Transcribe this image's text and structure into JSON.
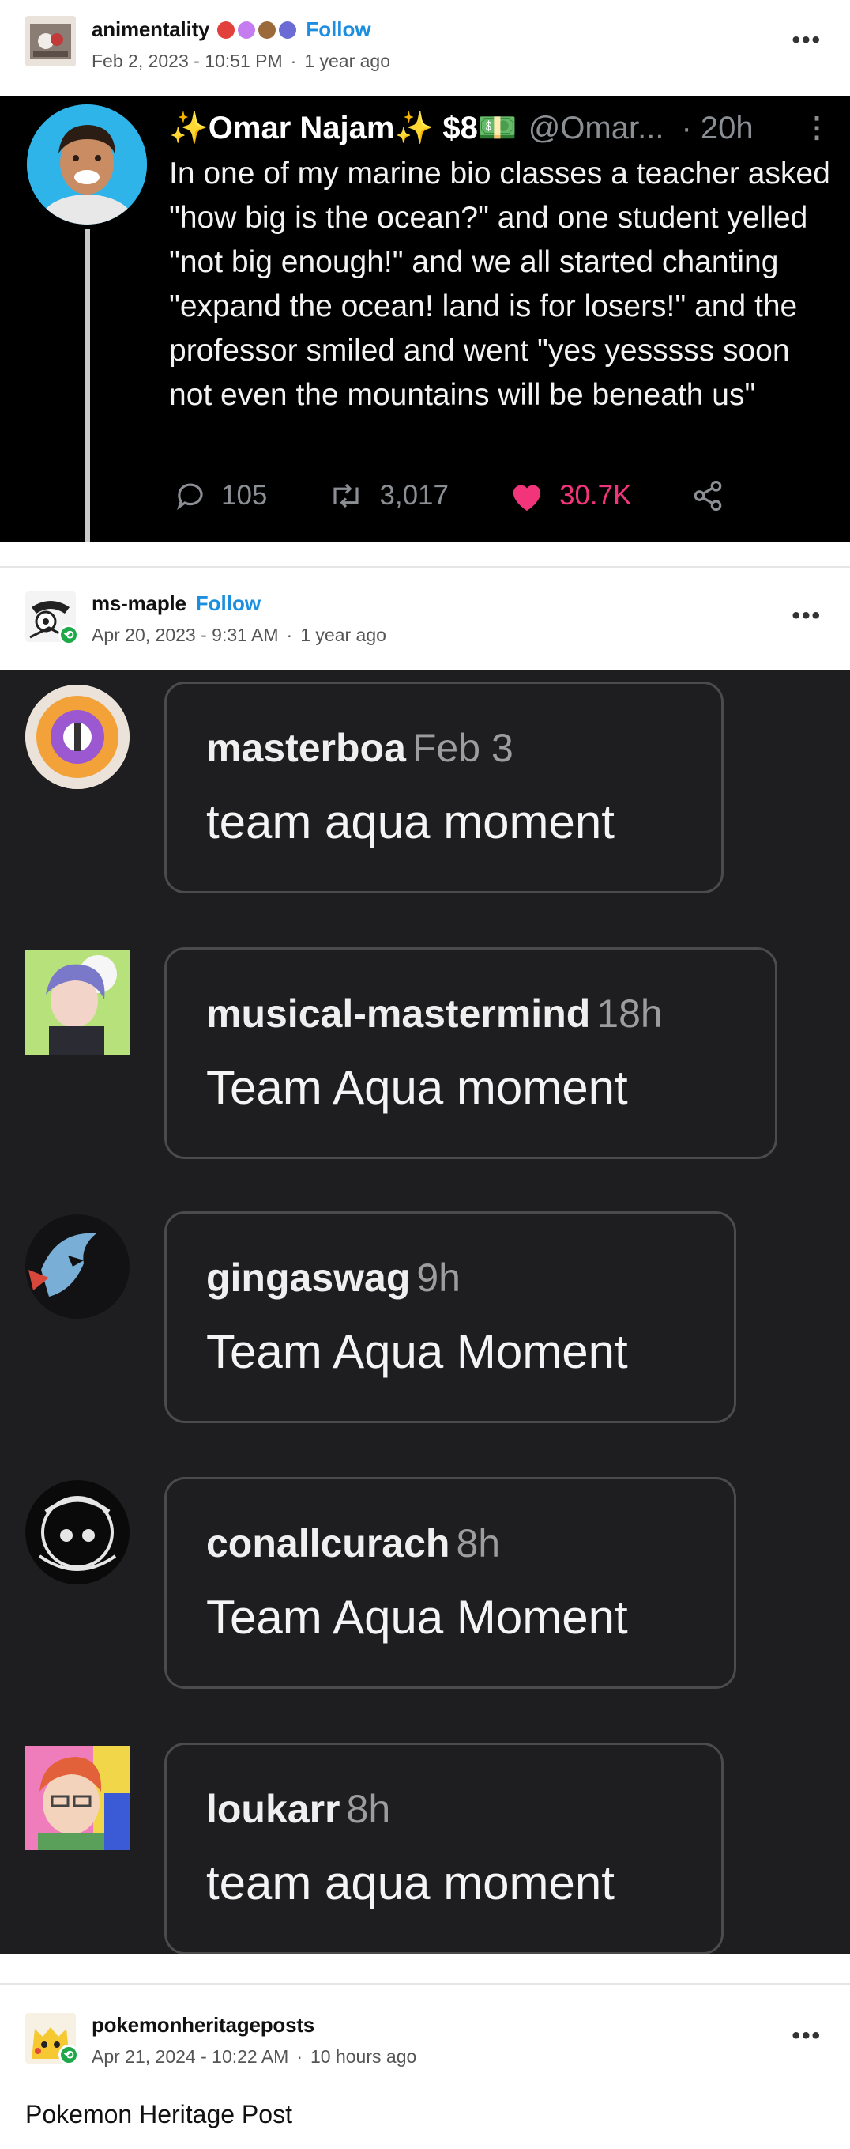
{
  "post1": {
    "blog_name": "animentality",
    "follow_label": "Follow",
    "date": "Feb 2, 2023 - 10:51 PM",
    "ago": "1 year ago",
    "badge_colors": [
      "#e2403b",
      "#c47cf0",
      "#9a6a3a",
      "#6b6bd6"
    ],
    "tweet": {
      "display_name": "✨Omar Najam✨ $8💵",
      "handle": "@Omar...",
      "time": "· 20h",
      "text": "In one of my marine bio classes a teacher asked \"how big is the ocean?\" and one student yelled \"not big enough!\" and we all started chanting \"expand the ocean! land is for losers!\" and the professor smiled and went \"yes yesssss soon not even the mountains will be beneath us\"",
      "replies": "105",
      "retweets": "3,017",
      "likes": "30.7K",
      "like_color": "#f2357a"
    }
  },
  "post2": {
    "blog_name": "ms-maple",
    "follow_label": "Follow",
    "date": "Apr 20, 2023 - 9:31 AM",
    "ago": "1 year ago",
    "comments": [
      {
        "user": "masterboa",
        "time": "Feb 3",
        "text": "team aqua moment"
      },
      {
        "user": "musical-mastermind",
        "time": "18h",
        "text": "Team Aqua moment"
      },
      {
        "user": "gingaswag",
        "time": "9h",
        "text": "Team Aqua Moment"
      },
      {
        "user": "conallcurach",
        "time": "8h",
        "text": "Team Aqua Moment"
      },
      {
        "user": "loukarr",
        "time": "8h",
        "text": "team aqua moment"
      }
    ]
  },
  "post3": {
    "blog_name": "pokemonheritageposts",
    "date": "Apr 21, 2024 - 10:22 AM",
    "ago": "10 hours ago",
    "body": "Pokemon Heritage Post"
  },
  "accent_follow": "#1b8ee0",
  "reblog_badge_color": "#1ea84a"
}
